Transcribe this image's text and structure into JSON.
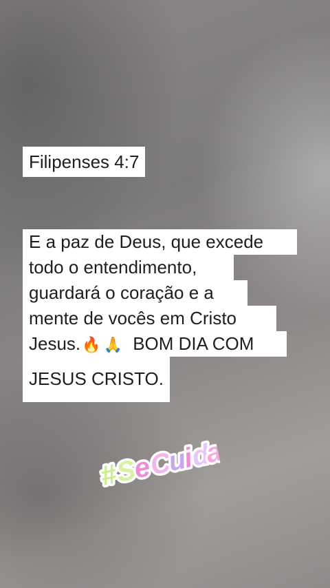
{
  "reference": "Filipenses 4:7",
  "verse_lines": [
    "E a paz de Deus, que excede",
    "todo o entendimento,",
    "guardará o coração e a",
    "mente de vocês em Cristo",
    "Jesus.",
    "BOM DIA COM",
    "JESUS CRISTO."
  ],
  "emojis": {
    "fire": "🔥",
    "pray": "🙏"
  },
  "sticker": {
    "hash": "#",
    "letters": [
      "S",
      "e",
      "C",
      "u",
      "i",
      "d",
      "a"
    ],
    "colors": [
      "#c9ef8a",
      "#d6f3a2",
      "#f08bd8",
      "#f2b6ea",
      "#c7a7f2",
      "#f08bd8",
      "#e7c6f4",
      "#f3a9e3"
    ]
  }
}
